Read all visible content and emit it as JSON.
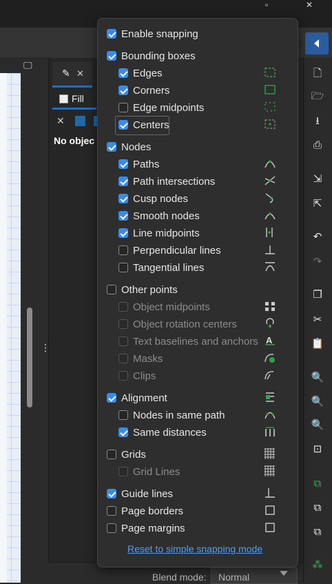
{
  "background": {
    "document_tab_icon": "pen-icon",
    "fill_tab_label": "Fill",
    "no_object_text": "No objec",
    "blend_mode_label": "Blend mode:",
    "blend_mode_value": "Normal"
  },
  "snapping": {
    "enable": {
      "label": "Enable snapping",
      "checked": true
    },
    "bounding_boxes": {
      "label": "Bounding boxes",
      "checked": true
    },
    "edges": {
      "label": "Edges",
      "checked": true
    },
    "corners": {
      "label": "Corners",
      "checked": true
    },
    "edge_midpoints": {
      "label": "Edge midpoints",
      "checked": false
    },
    "centers": {
      "label": "Centers",
      "checked": true
    },
    "nodes": {
      "label": "Nodes",
      "checked": true
    },
    "paths": {
      "label": "Paths",
      "checked": true
    },
    "path_intersections": {
      "label": "Path intersections",
      "checked": true
    },
    "cusp_nodes": {
      "label": "Cusp nodes",
      "checked": true
    },
    "smooth_nodes": {
      "label": "Smooth nodes",
      "checked": true
    },
    "line_midpoints": {
      "label": "Line midpoints",
      "checked": true
    },
    "perpendicular_lines": {
      "label": "Perpendicular lines",
      "checked": false
    },
    "tangential_lines": {
      "label": "Tangential lines",
      "checked": false
    },
    "other_points": {
      "label": "Other points",
      "checked": false
    },
    "object_midpoints": {
      "label": "Object midpoints",
      "checked": false
    },
    "object_rotation_centers": {
      "label": "Object rotation centers",
      "checked": false
    },
    "text_baselines": {
      "label": "Text baselines and anchors",
      "checked": false
    },
    "masks": {
      "label": "Masks",
      "checked": false
    },
    "clips": {
      "label": "Clips",
      "checked": false
    },
    "alignment": {
      "label": "Alignment",
      "checked": true
    },
    "nodes_same_path": {
      "label": "Nodes in same path",
      "checked": false
    },
    "same_distances": {
      "label": "Same distances",
      "checked": true
    },
    "grids": {
      "label": "Grids",
      "checked": false
    },
    "grid_lines": {
      "label": "Grid Lines",
      "checked": false
    },
    "guide_lines": {
      "label": "Guide lines",
      "checked": true
    },
    "page_borders": {
      "label": "Page borders",
      "checked": false
    },
    "page_margins": {
      "label": "Page margins",
      "checked": false
    },
    "reset_link": "Reset to simple snapping mode"
  },
  "sidebar_icons": [
    "new-document-icon",
    "open-icon",
    "save-icon",
    "print-icon",
    "import-icon",
    "export-icon",
    "undo-icon",
    "redo-icon",
    "copy-icon",
    "cut-icon",
    "paste-icon",
    "zoom-selection-icon",
    "zoom-drawing-icon",
    "zoom-page-icon",
    "zoom-center-icon",
    "duplicate-icon",
    "clone-icon",
    "unlink-clone-icon",
    "xml-editor-icon"
  ],
  "colors": {
    "accent": "#3a8be6",
    "snap_icon_green": "#2fa34a",
    "link": "#5a9be8"
  }
}
